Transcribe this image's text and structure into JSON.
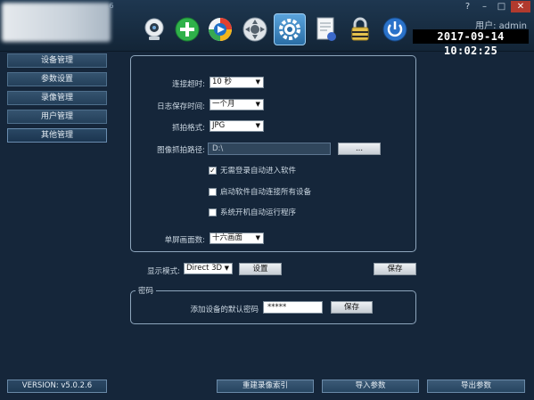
{
  "window": {
    "version_tag": ".6",
    "controls": {
      "help": "?",
      "minimize": "–",
      "maximize": "□",
      "close": "✕"
    },
    "user_line": "用户: admin",
    "datetime": "2017-09-14 10:02:25"
  },
  "toolbar": {
    "icons": [
      "webcam-icon",
      "add-icon",
      "playback-icon",
      "ptz-icon",
      "settings-icon",
      "log-icon",
      "lock-icon",
      "power-icon"
    ],
    "active": "settings-icon"
  },
  "sidebar": {
    "items": [
      {
        "label": "设备管理"
      },
      {
        "label": "参数设置"
      },
      {
        "label": "录像管理"
      },
      {
        "label": "用户管理"
      },
      {
        "label": "其他管理"
      }
    ],
    "active_index": 4
  },
  "settings": {
    "connect_timeout_label": "连接超时:",
    "connect_timeout_value": "10 秒",
    "log_retention_label": "日志保存时间:",
    "log_retention_value": "一个月",
    "capture_format_label": "抓拍格式:",
    "capture_format_value": "JPG",
    "capture_path_label": "图像抓拍路径:",
    "capture_path_value": "D:\\",
    "browse_label": "...",
    "checkboxes": [
      {
        "label": "无需登录自动进入软件",
        "checked": true
      },
      {
        "label": "启动软件自动连接所有设备",
        "checked": false
      },
      {
        "label": "系统开机自动运行程序",
        "checked": false
      }
    ],
    "split_screen_label": "单屏画面数:",
    "split_screen_value": "十六画面"
  },
  "display": {
    "mode_label": "显示模式:",
    "mode_value": "Direct 3D",
    "settings_button": "设置",
    "save_button": "保存"
  },
  "password": {
    "section_title": "密码",
    "label": "添加设备的默认密码",
    "value": "*****",
    "save_button": "保存"
  },
  "footer": {
    "version": "VERSION: v5.0.2.6",
    "rebuild_index": "重建录像索引",
    "import_params": "导入参数",
    "export_params": "导出参数"
  },
  "colors": {
    "background": "#15263a",
    "accent": "#2a6ea6",
    "close": "#b13a2e"
  }
}
